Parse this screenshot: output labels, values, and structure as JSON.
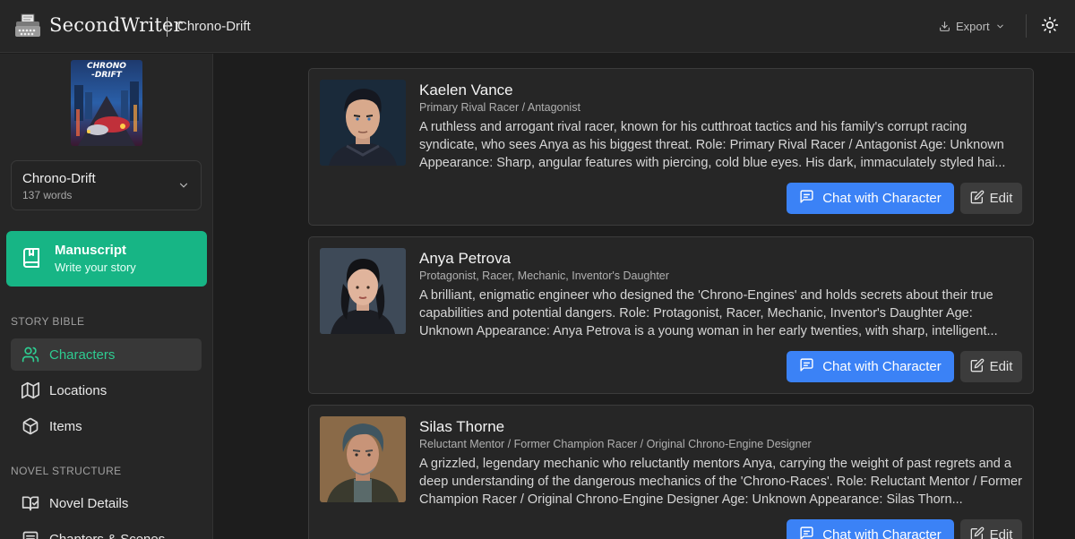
{
  "header": {
    "brand": "SecondWriter",
    "project_name": "Chrono-Drift",
    "export_label": "Export"
  },
  "sidebar": {
    "cover_title": "CHRONO -DRIFT",
    "project": {
      "title": "Chrono-Drift",
      "words": "137 words"
    },
    "manuscript": {
      "title": "Manuscript",
      "subtitle": "Write your story"
    },
    "story_bible_label": "STORY BIBLE",
    "story_bible_items": [
      {
        "label": "Characters",
        "icon": "users-icon",
        "active": true
      },
      {
        "label": "Locations",
        "icon": "map-icon",
        "active": false
      },
      {
        "label": "Items",
        "icon": "box-icon",
        "active": false
      }
    ],
    "novel_structure_label": "NOVEL STRUCTURE",
    "novel_structure_items": [
      {
        "label": "Novel Details",
        "icon": "book-check-icon"
      },
      {
        "label": "Chapters & Scenes",
        "icon": "list-icon"
      }
    ]
  },
  "characters": [
    {
      "name": "Kaelen Vance",
      "role": "Primary Rival Racer / Antagonist",
      "description": "A ruthless and arrogant rival racer, known for his cutthroat tactics and his family's corrupt racing syndicate, who sees Anya as his biggest threat. Role: Primary Rival Racer / Antagonist Age: Unknown Appearance: Sharp, angular features with piercing, cold blue eyes. His dark, immaculately styled hai...",
      "chat_label": "Chat with Character",
      "edit_label": "Edit"
    },
    {
      "name": "Anya Petrova",
      "role": "Protagonist, Racer, Mechanic, Inventor's Daughter",
      "description": "A brilliant, enigmatic engineer who designed the 'Chrono-Engines' and holds secrets about their true capabilities and potential dangers. Role: Protagonist, Racer, Mechanic, Inventor's Daughter Age: Unknown Appearance: Anya Petrova is a young woman in her early twenties, with sharp, intelligent...",
      "chat_label": "Chat with Character",
      "edit_label": "Edit"
    },
    {
      "name": "Silas Thorne",
      "role": "Reluctant Mentor / Former Champion Racer / Original Chrono-Engine Designer",
      "description": "A grizzled, legendary mechanic who reluctantly mentors Anya, carrying the weight of past regrets and a deep understanding of the dangerous mechanics of the 'Chrono-Races'. Role: Reluctant Mentor / Former Champion Racer / Original Chrono-Engine Designer Age: Unknown Appearance: Silas Thorn...",
      "chat_label": "Chat with Character",
      "edit_label": "Edit"
    }
  ],
  "colors": {
    "accent_green": "#17b585",
    "accent_blue": "#3b82f6",
    "active_text": "#2ecc91"
  }
}
